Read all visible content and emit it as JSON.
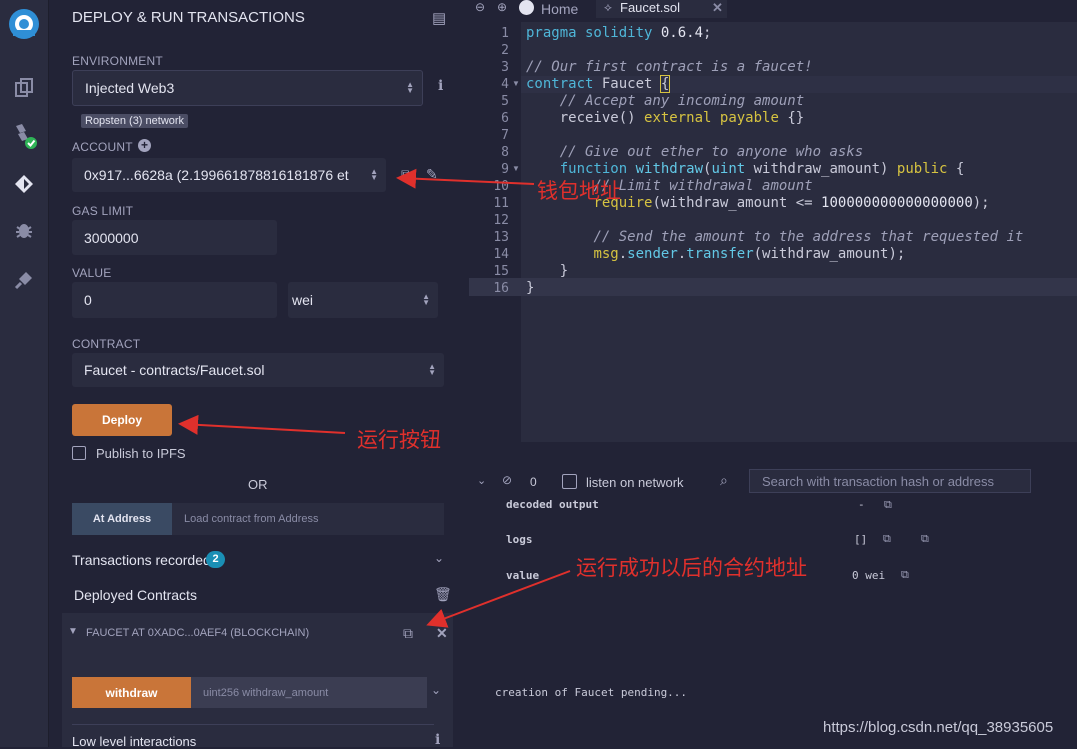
{
  "panel": {
    "title": "DEPLOY & RUN TRANSACTIONS",
    "environment_label": "ENVIRONMENT",
    "environment_value": "Injected Web3",
    "network_badge": "Ropsten (3) network",
    "account_label": "ACCOUNT",
    "account_value": "0x917...6628a (2.199661878816181876 et",
    "gas_limit_label": "GAS LIMIT",
    "gas_limit_value": "3000000",
    "value_label": "VALUE",
    "value_value": "0",
    "value_unit": "wei",
    "contract_label": "CONTRACT",
    "contract_value": "Faucet - contracts/Faucet.sol",
    "deploy_label": "Deploy",
    "publish_label": "Publish to IPFS",
    "or_label": "OR",
    "at_address_label": "At Address",
    "at_address_placeholder": "Load contract from Address",
    "transactions_recorded_label": "Transactions recorded",
    "transactions_recorded_count": "2",
    "deployed_contracts_label": "Deployed Contracts",
    "instance_label": "FAUCET AT 0XADC...0AEF4 (BLOCKCHAIN)",
    "withdraw_label": "withdraw",
    "withdraw_placeholder": "uint256 withdraw_amount",
    "low_level_label": "Low level interactions"
  },
  "tabs": {
    "home_label": "Home",
    "file_label": "Faucet.sol"
  },
  "editor": {
    "line_numbers": [
      "1",
      "2",
      "3",
      "4",
      "5",
      "6",
      "7",
      "8",
      "9",
      "10",
      "11",
      "12",
      "13",
      "14",
      "15",
      "16"
    ]
  },
  "terminal": {
    "pending_count": "0",
    "listen_label": "listen on network",
    "search_placeholder": "Search with transaction hash or address",
    "decoded_output_key": "decoded output",
    "decoded_output_val": "-",
    "logs_key": "logs",
    "logs_val": "[]",
    "value_key": "value",
    "value_val": "0 wei",
    "pending_message": "creation of Faucet pending..."
  },
  "annotations": {
    "wallet_address": "钱包地址",
    "run_button": "运行按钮",
    "contract_address": "运行成功以后的合约地址"
  },
  "watermark": "https://blog.csdn.net/qq_38935605",
  "colors": {
    "accent_orange": "#c97539",
    "badge_blue": "#1a8fb5",
    "annotation_red": "#e0302c",
    "check_green": "#2fb457"
  }
}
